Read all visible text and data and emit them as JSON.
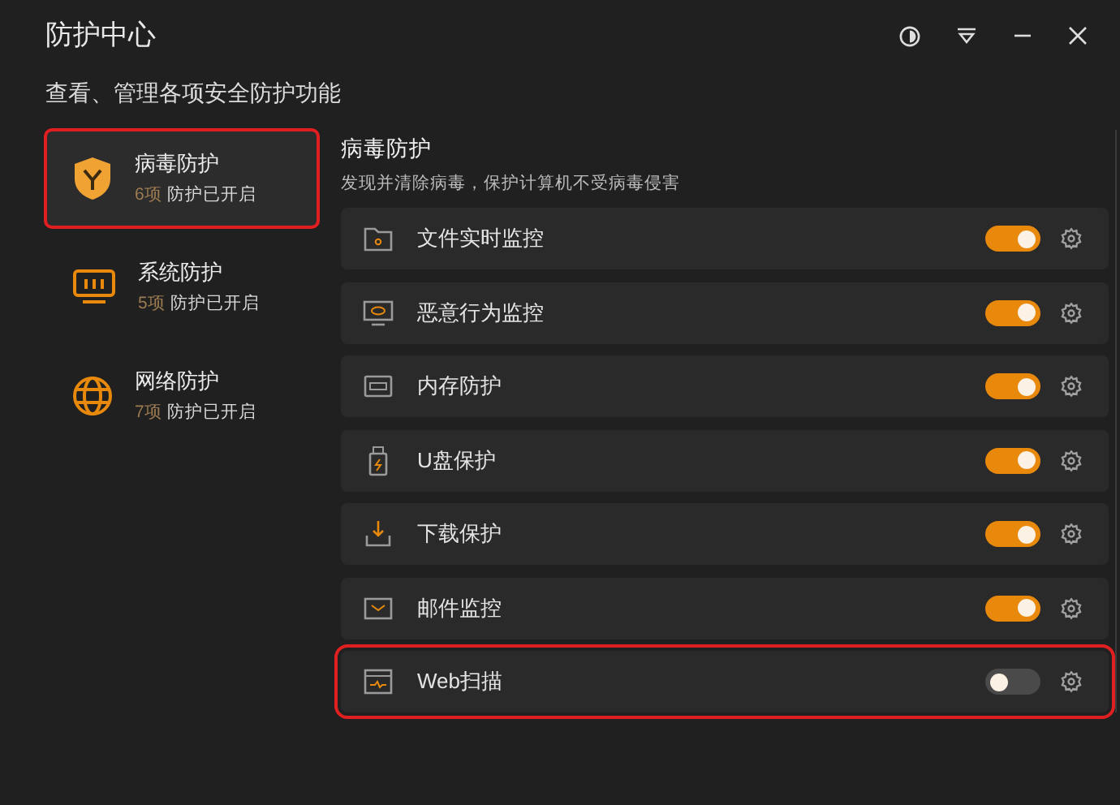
{
  "window": {
    "title": "防护中心"
  },
  "subtitle": "查看、管理各项安全防护功能",
  "sidebar": {
    "items": [
      {
        "name": "病毒防护",
        "count": "6项",
        "status": "防护已开启",
        "selected": true,
        "highlighted": true
      },
      {
        "name": "系统防护",
        "count": "5项",
        "status": "防护已开启",
        "selected": false,
        "highlighted": false
      },
      {
        "name": "网络防护",
        "count": "7项",
        "status": "防护已开启",
        "selected": false,
        "highlighted": false
      }
    ]
  },
  "section": {
    "title": "病毒防护",
    "description": "发现并清除病毒，保护计算机不受病毒侵害"
  },
  "features": [
    {
      "name": "文件实时监控",
      "on": true,
      "highlighted": false
    },
    {
      "name": "恶意行为监控",
      "on": true,
      "highlighted": false
    },
    {
      "name": "内存防护",
      "on": true,
      "highlighted": false
    },
    {
      "name": "U盘保护",
      "on": true,
      "highlighted": false
    },
    {
      "name": "下载保护",
      "on": true,
      "highlighted": false
    },
    {
      "name": "邮件监控",
      "on": true,
      "highlighted": false
    },
    {
      "name": "Web扫描",
      "on": false,
      "highlighted": true
    }
  ]
}
